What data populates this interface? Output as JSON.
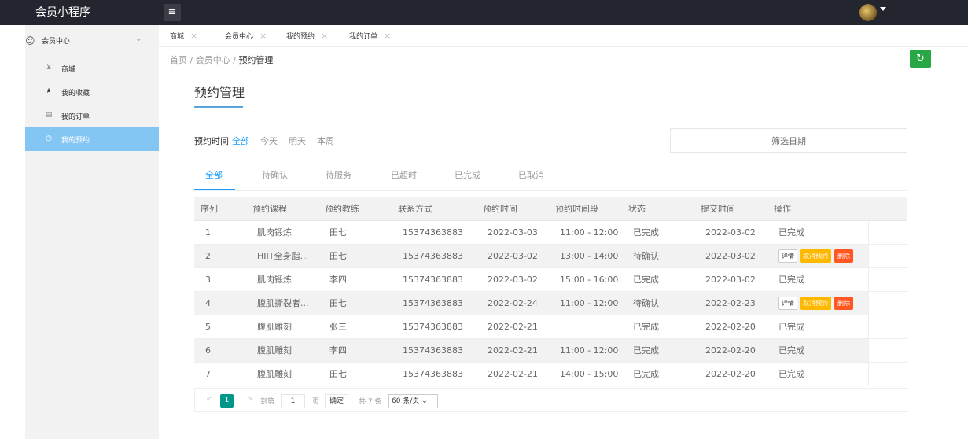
{
  "app": {
    "title": "会员小程序",
    "menu_icon": "≡"
  },
  "sidebar": {
    "group": "会员中心",
    "items": [
      {
        "label": "商城",
        "icon": "cart-icon"
      },
      {
        "label": "我的收藏",
        "icon": "star-icon"
      },
      {
        "label": "我的订单",
        "icon": "order-icon"
      },
      {
        "label": "我的预约",
        "icon": "clock-icon",
        "active": true
      }
    ]
  },
  "tabs": [
    "商城",
    "会员中心",
    "我的预约",
    "我的订单"
  ],
  "breadcrumb": {
    "home": "首页",
    "sep": "/",
    "level2": "会员中心",
    "current": "预约管理"
  },
  "page": {
    "title": "预约管理"
  },
  "filter": {
    "label": "预约时间",
    "options": [
      "全部",
      "今天",
      "明天",
      "本周"
    ],
    "date_placeholder": "筛选日期"
  },
  "status_tabs": [
    "全部",
    "待确认",
    "待服务",
    "已超时",
    "已完成",
    "已取消"
  ],
  "table": {
    "headers": [
      "序列",
      "预约课程",
      "预约教练",
      "联系方式",
      "预约时间",
      "预约时间段",
      "状态",
      "提交时间",
      "操作"
    ],
    "rows": [
      {
        "no": "1",
        "course": "肌肉锻炼",
        "coach": "田七",
        "phone": "15374363883",
        "date": "2022-03-03",
        "slot": "11:00 - 12:00",
        "status": "已完成",
        "submitted": "2022-03-02",
        "op": "已完成"
      },
      {
        "no": "2",
        "course": "HIIT全身脂...",
        "coach": "田七",
        "phone": "15374363883",
        "date": "2022-03-02",
        "slot": "13:00 - 14:00",
        "status": "待确认",
        "submitted": "2022-03-02",
        "op": ""
      },
      {
        "no": "3",
        "course": "肌肉锻炼",
        "coach": "李四",
        "phone": "15374363883",
        "date": "2022-03-02",
        "slot": "15:00 - 16:00",
        "status": "已完成",
        "submitted": "2022-03-02",
        "op": "已完成"
      },
      {
        "no": "4",
        "course": "腹肌撕裂者...",
        "coach": "田七",
        "phone": "15374363883",
        "date": "2022-02-24",
        "slot": "11:00 - 12:00",
        "status": "待确认",
        "submitted": "2022-02-23",
        "op": ""
      },
      {
        "no": "5",
        "course": "腹肌雕刻",
        "coach": "张三",
        "phone": "15374363883",
        "date": "2022-02-21",
        "slot": "",
        "status": "已完成",
        "submitted": "2022-02-20",
        "op": "已完成"
      },
      {
        "no": "6",
        "course": "腹肌雕刻",
        "coach": "李四",
        "phone": "15374363883",
        "date": "2022-02-21",
        "slot": "11:00 - 12:00",
        "status": "已完成",
        "submitted": "2022-02-20",
        "op": "已完成"
      },
      {
        "no": "7",
        "course": "腹肌雕刻",
        "coach": "田七",
        "phone": "15374363883",
        "date": "2022-02-21",
        "slot": "14:00 - 15:00",
        "status": "已完成",
        "submitted": "2022-02-20",
        "op": "已完成"
      }
    ],
    "actions": {
      "detail": "详情",
      "cancel": "取消预约",
      "delete": "删除"
    }
  },
  "pager": {
    "current": "1",
    "goto": "到第",
    "page_input": "1",
    "page_unit": "页",
    "confirm": "确定",
    "total": "共 7 条",
    "page_size": "60 条/页"
  }
}
